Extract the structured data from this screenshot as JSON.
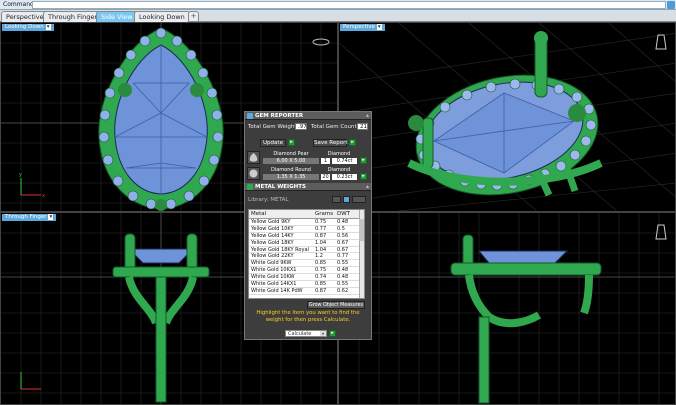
{
  "command_bar": {
    "label": "Command:"
  },
  "tabs": [
    {
      "label": "Perspective",
      "active": false
    },
    {
      "label": "Through Finger",
      "active": false
    },
    {
      "label": "Side View",
      "active": true
    },
    {
      "label": "Looking Down",
      "active": false
    }
  ],
  "add_tab": "+",
  "viewports": {
    "top_left": {
      "label": "Looking Down"
    },
    "top_right": {
      "label": "Perspective"
    },
    "bottom_left": {
      "label": "Through Finger"
    }
  },
  "gem_reporter": {
    "title": "GEM REPORTER",
    "total_weight_label": "Total Gem Weight",
    "total_weight_value": ".97",
    "total_count_label": "Total Gem Count",
    "total_count_value": "21",
    "update_label": "Update",
    "save_report_label": "Save Report",
    "gems": [
      {
        "name": "Diamond Pear",
        "size": "6.00 X 5.00",
        "type": "Diamond",
        "qty": "1",
        "weight": "0.74ct"
      },
      {
        "name": "Diamond Round",
        "size": "1.35 X 1.35",
        "type": "Diamond",
        "qty": "20",
        "weight": "0.23ct"
      }
    ]
  },
  "metal_weights": {
    "title": "METAL WEIGHTS",
    "library_label": "Library: METAL",
    "columns": [
      "Metal",
      "Grams",
      "DWT"
    ],
    "rows": [
      [
        "Yellow Gold 9KY",
        "0.75",
        "0.48"
      ],
      [
        "Yellow Gold 10KY",
        "0.77",
        "0.5"
      ],
      [
        "Yellow Gold 14KY",
        "0.87",
        "0.56"
      ],
      [
        "Yellow Gold 18KY",
        "1.04",
        "0.67"
      ],
      [
        "Yellow Gold 18KY Royal",
        "1.04",
        "0.67"
      ],
      [
        "Yellow Gold 22KY",
        "1.2",
        "0.77"
      ],
      [
        "White Gold 9KW",
        "0.85",
        "0.55"
      ],
      [
        "White Gold 10KX1",
        "0.75",
        "0.48"
      ],
      [
        "White Gold 10KW",
        "0.74",
        "0.48"
      ],
      [
        "White Gold 14KX1",
        "0.85",
        "0.55"
      ],
      [
        "White Gold 14K PdW",
        "0.87",
        "0.62"
      ]
    ],
    "object_button": "Grow Object Measures",
    "hint": "Highlight the item you want to find the weight for then press Calculate.",
    "calculate_select": "Calculate"
  },
  "colors": {
    "metal_green": "#2fa84f",
    "gem_blue": "#6f93d8",
    "accent": "#5fa8dc"
  }
}
